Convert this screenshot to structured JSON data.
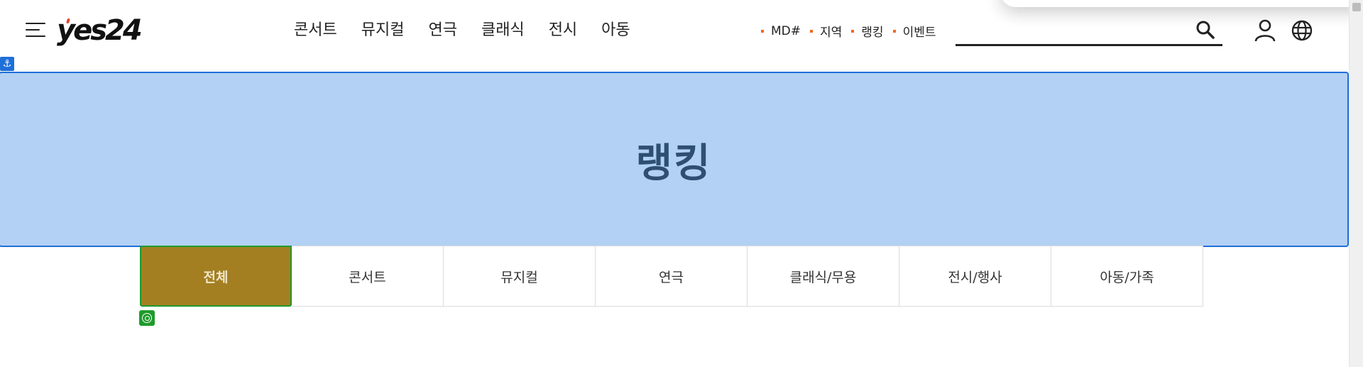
{
  "header": {
    "logo_text": "yes24",
    "main_nav": [
      "콘서트",
      "뮤지컬",
      "연극",
      "클래식",
      "전시",
      "아동"
    ],
    "sub_nav": [
      "MD#",
      "지역",
      "랭킹",
      "이벤트"
    ],
    "search": {
      "value": "",
      "placeholder": ""
    }
  },
  "banner": {
    "title": "랭킹"
  },
  "tabs": {
    "items": [
      "전체",
      "콘서트",
      "뮤지컬",
      "연극",
      "클래식/무용",
      "전시/행사",
      "아동/가족"
    ],
    "active_index": 0
  },
  "colors": {
    "accent_dot": "#f06b1d",
    "banner_fill": "#b3d1f4",
    "banner_border": "#1f6fd9",
    "active_tab": "#a37f22",
    "active_tab_border": "#1e9b2c"
  },
  "icons": [
    "menu-icon",
    "search-icon",
    "user-icon",
    "globe-icon",
    "anchor-icon",
    "target-icon"
  ]
}
